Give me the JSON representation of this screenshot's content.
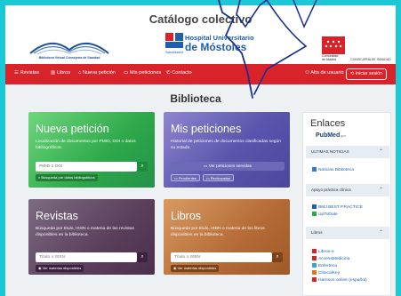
{
  "header": {
    "title": "Catálogo colectivo",
    "bvm_caption": "Biblioteca Virtual Consejería de Sanidad",
    "hospital_line1": "Hospital Universitario",
    "hospital_line2": "de Móstoles",
    "hospital_small": "SaludMadrid",
    "cm_text": "Comunidad\nde Madrid",
    "cm_consejeria": "CONSEJERÍA DE SANIDAD"
  },
  "nav": {
    "items": [
      "Revistas",
      "Libros",
      "Nueva petición",
      "Mis peticiones",
      "Contacto"
    ],
    "signup": "Alta de usuario",
    "login": "Iniciar sesión"
  },
  "page_title": "Biblioteca",
  "cards": {
    "nueva": {
      "title": "Nueva petición",
      "desc": "Localización de documentos por PMID, DOI o datos bibliográficos.",
      "placeholder": "PMID o DOI",
      "chip": "Búsqueda por datos bibliográficos"
    },
    "mis": {
      "title": "Mis peticiones",
      "desc": "Historial de peticiones de documentos clasificadas según su estado.",
      "button": "Ver peticiones servidas",
      "chip1": "Pendientes",
      "chip2": "Rechazadas"
    },
    "revistas": {
      "title": "Revistas",
      "desc": "Búsqueda por título, ISSN o materia de las revistas disponibles en la biblioteca.",
      "placeholder": "Título o ISSN",
      "chip": "Ver materias disponibles"
    },
    "libros": {
      "title": "Libros",
      "desc": "Búsqueda por título, ISBN o materia de los libros disponibles en la biblioteca.",
      "placeholder": "Título o ISBN",
      "chip": "Ver materias disponibles"
    }
  },
  "sidebar": {
    "title": "Enlaces",
    "pubmed": "PubMed",
    "pubmed_gov": ".gov",
    "sections": [
      {
        "label": "ULTIMAS NOTICIAS",
        "links": [
          "Noticias Biblioteca"
        ]
      },
      {
        "label": "Apoyo práctica clínica",
        "links": [
          "BMJ BEST PRACTICE",
          "UpToDate"
        ]
      },
      {
        "label": "Libros",
        "links": [
          "Libros-e",
          "AccessMedicina",
          "Enferteca",
          "ClinicalKey",
          "Harrison online (español)"
        ]
      }
    ]
  },
  "colors": {
    "accent_cyan": "#1cc7d6",
    "nav_red": "#d8232a",
    "green_card": "#2ea84a",
    "purple_card": "#5a55ac",
    "plum_card": "#5a3f5b",
    "orange_card": "#b46a35"
  }
}
